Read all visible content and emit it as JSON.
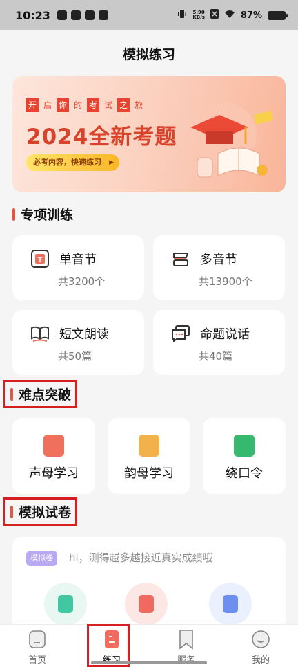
{
  "status": {
    "time": "10:23",
    "net_speed_top": "5.90",
    "net_speed_bottom": "KB/s",
    "battery": "87%"
  },
  "header": {
    "title": "模拟练习"
  },
  "banner": {
    "tag_chars": [
      "开",
      "启",
      "你",
      "的",
      "考",
      "试",
      "之",
      "旅"
    ],
    "title": "2024全新考题",
    "subtitle": "必考内容，快速练习"
  },
  "sections": {
    "special": "专项训练",
    "difficulty": "难点突破",
    "mock": "模拟试卷"
  },
  "special_items": [
    {
      "name": "单音节",
      "count": "共3200个",
      "icon": "t-letter-icon"
    },
    {
      "name": "多音节",
      "count": "共13900个",
      "icon": "stack-icon"
    },
    {
      "name": "短文朗读",
      "count": "共50篇",
      "icon": "book-icon"
    },
    {
      "name": "命题说话",
      "count": "共40篇",
      "icon": "chat-icon"
    }
  ],
  "difficulty_items": [
    {
      "label": "声母学习",
      "color": "#f0705e"
    },
    {
      "label": "韵母学习",
      "color": "#f2b14a"
    },
    {
      "label": "绕口令",
      "color": "#36b86f"
    }
  ],
  "mock": {
    "tag": "模拟卷",
    "text": "hi，测得越多越接近真实成绩哦",
    "circles": [
      {
        "bg": "#e8f7f2",
        "inner": "#41c7a2"
      },
      {
        "bg": "#fde7e5",
        "inner": "#f06a5f"
      },
      {
        "bg": "#eaf0fd",
        "inner": "#6d8ff0"
      }
    ]
  },
  "tabs": [
    {
      "label": "首页",
      "icon": "home-icon"
    },
    {
      "label": "练习",
      "icon": "practice-icon",
      "active": true
    },
    {
      "label": "服务",
      "icon": "bookmark-icon"
    },
    {
      "label": "我的",
      "icon": "profile-icon"
    }
  ]
}
